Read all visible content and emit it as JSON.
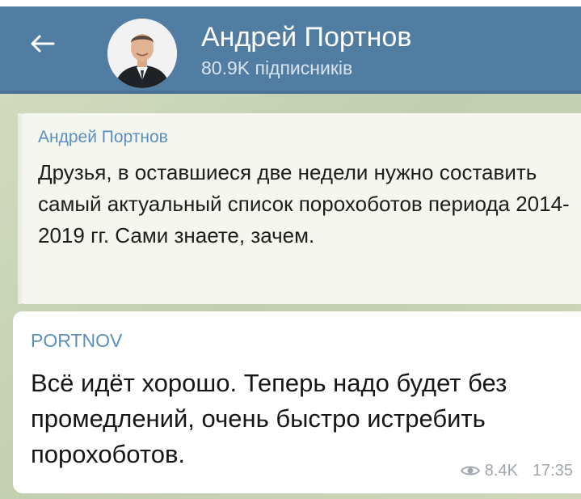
{
  "header": {
    "channel_name": "Андрей Портнов",
    "subscribers": "80.9K підписників",
    "back_icon": "arrow-left-icon",
    "avatar": "avatar"
  },
  "reply": {
    "author": "Андрей Портнов",
    "text": "Друзья, в оставшиеся две недели нужно составить самый актуальный список порохоботов периода 2014-2019 гг. Сами знаете, зачем."
  },
  "message": {
    "author": "PORTNOV",
    "text": "Всё идёт хорошо. Теперь надо будет без промедлений, очень быстро истребить порохоботов.",
    "views_icon": "eye-icon",
    "views": "8.4K",
    "time": "17:35"
  },
  "colors": {
    "header": "#527da3",
    "name_accent": "#5a8fbf",
    "bubble": "#ffffff",
    "reply_bubble": "#f5f7ee"
  }
}
